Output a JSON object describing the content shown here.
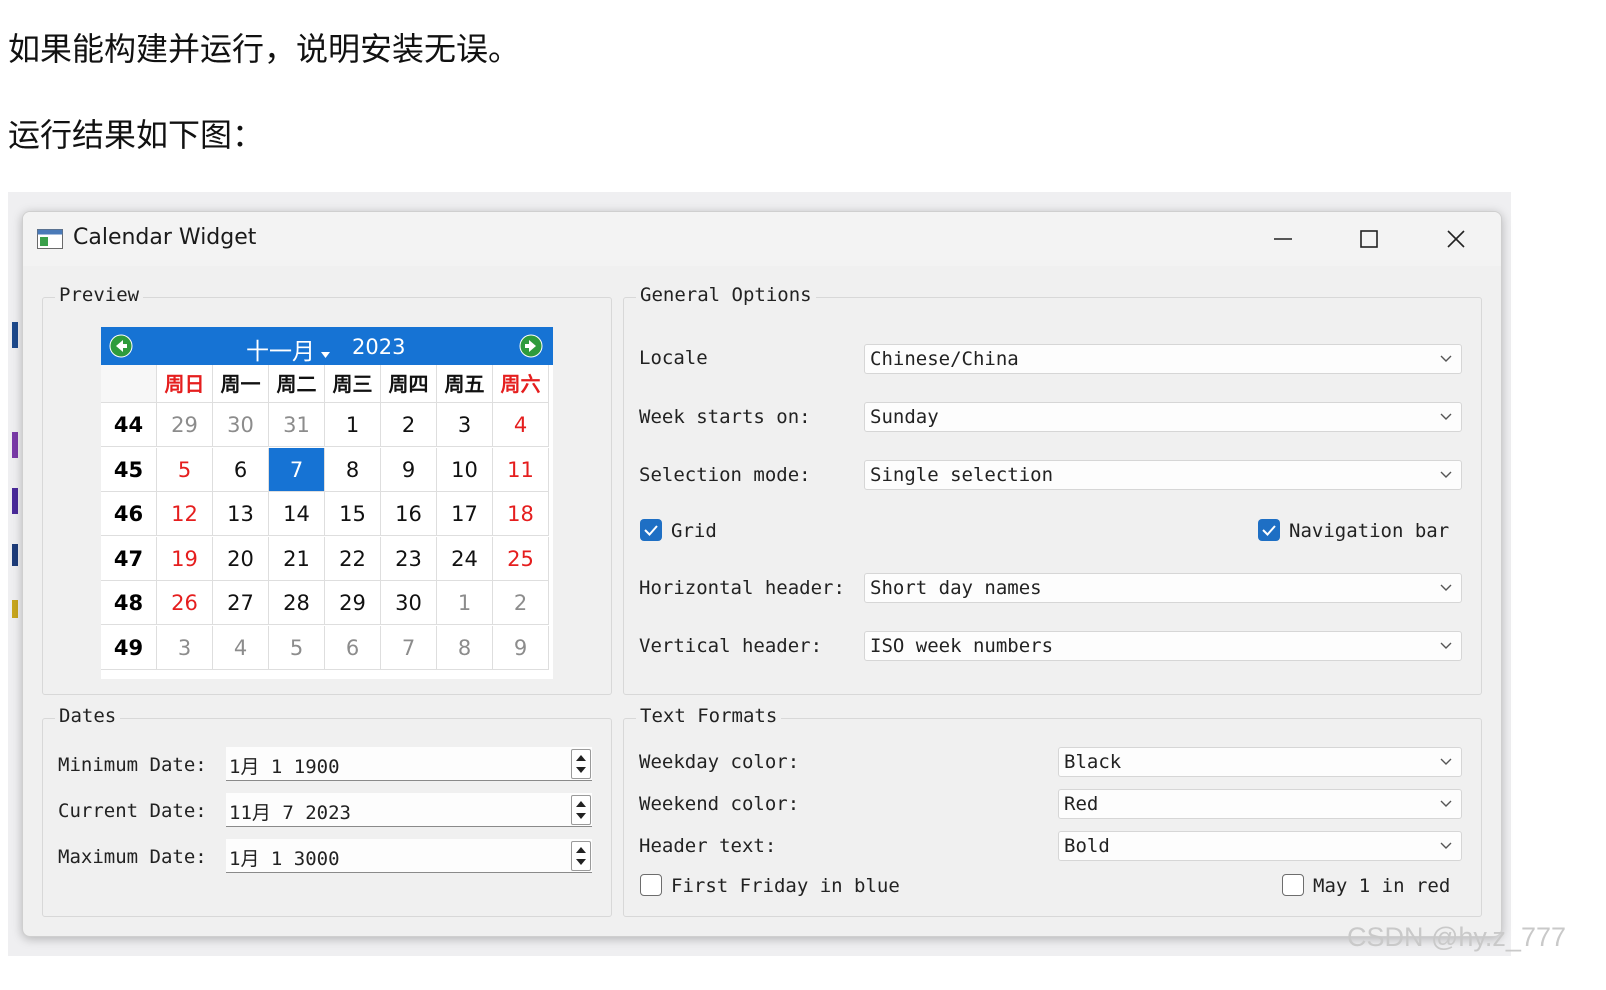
{
  "doc": {
    "line1": "如果能构建并运行，说明安装无误。",
    "line2": "运行结果如下图："
  },
  "window": {
    "title": "Calendar Widget",
    "controls": [
      "minimize-icon",
      "maximize-icon",
      "close-icon"
    ]
  },
  "preview": {
    "title": "Preview",
    "calendar": {
      "month": "十一月",
      "year": "2023",
      "day_headers": [
        "周日",
        "周一",
        "周二",
        "周三",
        "周四",
        "周五",
        "周六"
      ],
      "weeks": [
        {
          "week": "44",
          "days": [
            "29",
            "30",
            "31",
            "1",
            "2",
            "3",
            "4"
          ]
        },
        {
          "week": "45",
          "days": [
            "5",
            "6",
            "7",
            "8",
            "9",
            "10",
            "11"
          ]
        },
        {
          "week": "46",
          "days": [
            "12",
            "13",
            "14",
            "15",
            "16",
            "17",
            "18"
          ]
        },
        {
          "week": "47",
          "days": [
            "19",
            "20",
            "21",
            "22",
            "23",
            "24",
            "25"
          ]
        },
        {
          "week": "48",
          "days": [
            "26",
            "27",
            "28",
            "29",
            "30",
            "1",
            "2"
          ]
        },
        {
          "week": "49",
          "days": [
            "3",
            "4",
            "5",
            "6",
            "7",
            "8",
            "9"
          ]
        }
      ],
      "selected_day": "7",
      "colors": {
        "nav": "#1673d4",
        "weekend": "#e51e1e",
        "other_month": "#8c8c8c",
        "selected": "#1673d4"
      }
    }
  },
  "general": {
    "title": "General Options",
    "locale_label": "Locale",
    "locale_value": "Chinese/China",
    "week_start_label": "Week starts on:",
    "week_start_value": "Sunday",
    "selection_label": "Selection mode:",
    "selection_value": "Single selection",
    "grid_label": "Grid",
    "grid_checked": true,
    "navbar_label": "Navigation bar",
    "navbar_checked": true,
    "hheader_label": "Horizontal header:",
    "hheader_value": "Short day names",
    "vheader_label": "Vertical header:",
    "vheader_value": "ISO week numbers"
  },
  "dates": {
    "title": "Dates",
    "min_label": "Minimum Date:",
    "min_value": "1月 1 1900",
    "cur_label": "Current Date:",
    "cur_value": "11月 7 2023",
    "max_label": "Maximum Date:",
    "max_value": "1月 1 3000"
  },
  "formats": {
    "title": "Text Formats",
    "weekday_label": "Weekday color:",
    "weekday_value": "Black",
    "weekend_label": "Weekend color:",
    "weekend_value": "Red",
    "header_label": "Header text:",
    "header_value": "Bold",
    "friday_label": "First Friday in blue",
    "friday_checked": false,
    "may_label": "May 1 in red",
    "may_checked": false
  },
  "watermark": "CSDN @hy.z_777"
}
